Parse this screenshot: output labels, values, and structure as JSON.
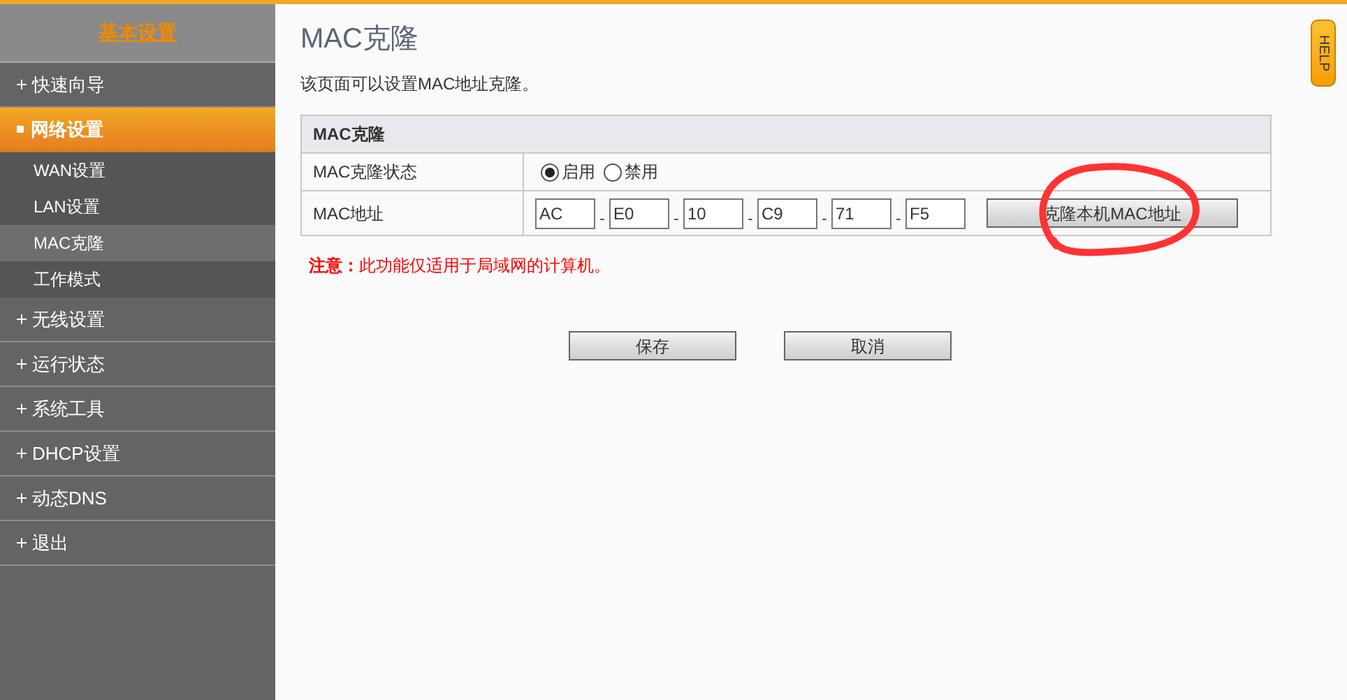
{
  "sidebar": {
    "title": "基本设置",
    "items": [
      {
        "label": "快速向导",
        "selected": false,
        "expanded": false
      },
      {
        "label": "网络设置",
        "selected": true,
        "expanded": true,
        "children": [
          {
            "label": "WAN设置",
            "selected": false
          },
          {
            "label": "LAN设置",
            "selected": false
          },
          {
            "label": "MAC克隆",
            "selected": true
          },
          {
            "label": "工作模式",
            "selected": false
          }
        ]
      },
      {
        "label": "无线设置",
        "selected": false,
        "expanded": false
      },
      {
        "label": "运行状态",
        "selected": false,
        "expanded": false
      },
      {
        "label": "系统工具",
        "selected": false,
        "expanded": false
      },
      {
        "label": "DHCP设置",
        "selected": false,
        "expanded": false
      },
      {
        "label": "动态DNS",
        "selected": false,
        "expanded": false
      },
      {
        "label": "退出",
        "selected": false,
        "expanded": false
      }
    ]
  },
  "page": {
    "title": "MAC克隆",
    "description": "该页面可以设置MAC地址克隆。"
  },
  "help_tab": "HELP",
  "form": {
    "heading": "MAC克隆",
    "status": {
      "label": "MAC克隆状态",
      "options": [
        {
          "label": "启用",
          "selected": true
        },
        {
          "label": "禁用",
          "selected": false
        }
      ]
    },
    "mac": {
      "label": "MAC地址",
      "octets": [
        "AC",
        "E0",
        "10",
        "C9",
        "71",
        "F5"
      ],
      "separator": "-",
      "clone_button": "克隆本机MAC地址"
    }
  },
  "note": {
    "prefix": "注意：",
    "text": "此功能仅适用于局域网的计算机。"
  },
  "buttons": [
    "保存",
    "取消"
  ]
}
